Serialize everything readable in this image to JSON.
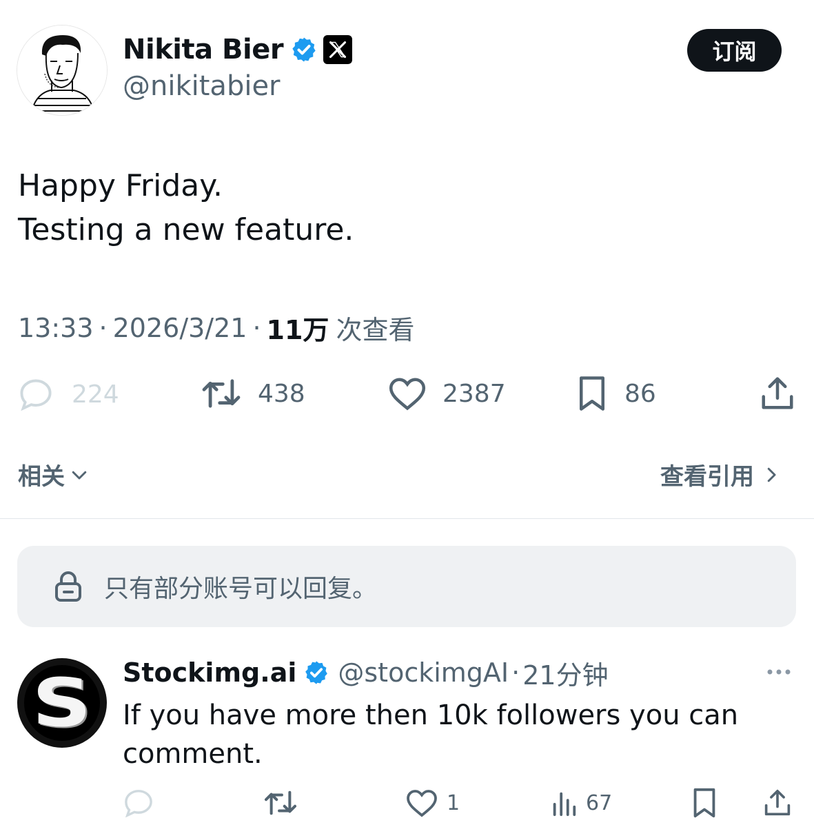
{
  "author": {
    "name": "Nikita Bier",
    "handle": "@nikitabier"
  },
  "subscribe_label": "订阅",
  "tweet": {
    "lines": [
      "Happy Friday.",
      "Testing a new feature."
    ],
    "time": "13:33",
    "date": "2026/3/21",
    "views_count": "11万",
    "views_label": "次查看",
    "separator": "·"
  },
  "actions": {
    "replies": "224",
    "retweets": "438",
    "likes": "2387",
    "bookmarks": "86"
  },
  "related_label": "相关",
  "view_quotes_label": "查看引用",
  "reply_restriction": "只有部分账号可以回复。",
  "reply": {
    "name": "Stockimg.ai",
    "handle": "@stockimgAI",
    "separator": "·",
    "time": "21分钟",
    "text": "If you have more then 10k followers you can comment.",
    "likes": "1",
    "views": "67",
    "avatar_letter": "S"
  },
  "colors": {
    "verified": "#1d9bf0",
    "text": "#0f1419",
    "muted": "#536471",
    "faded": "#cfd9de",
    "panel": "#eff1f3"
  }
}
